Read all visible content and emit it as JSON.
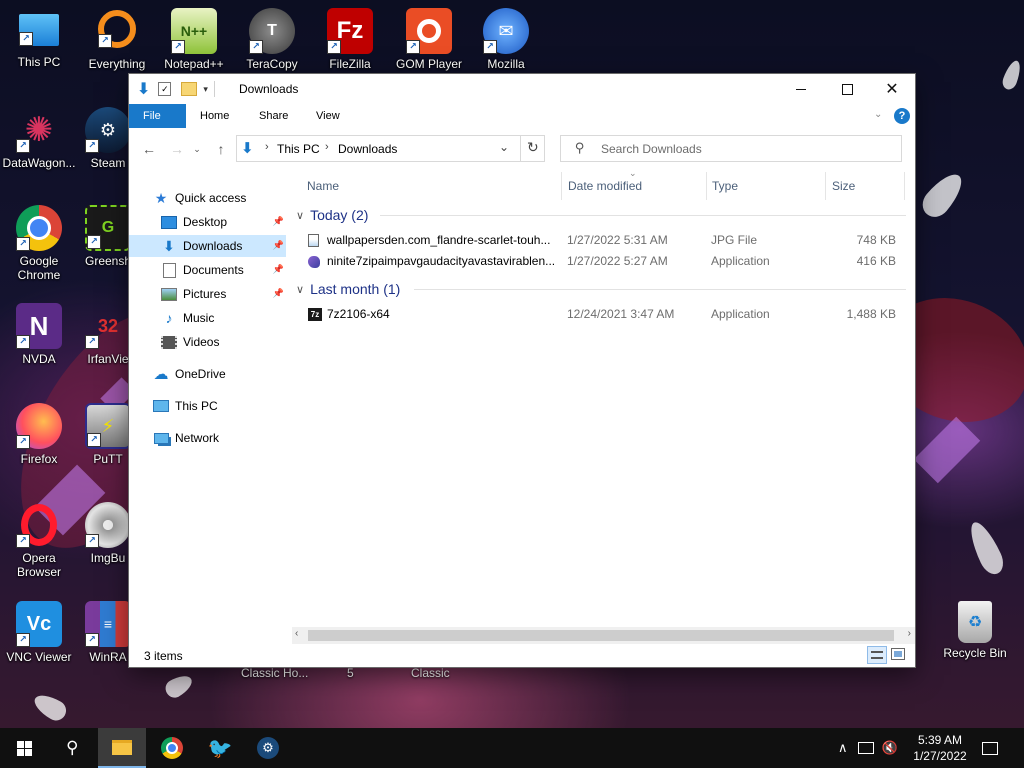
{
  "desktop": {
    "icons": [
      {
        "label": "This PC",
        "icon": "computer-icon"
      },
      {
        "label": "Everything",
        "icon": "magnifier-icon"
      },
      {
        "label": "Notepad++",
        "icon": "notepadpp-icon"
      },
      {
        "label": "TeraCopy",
        "icon": "teracopy-icon"
      },
      {
        "label": "FileZilla",
        "icon": "filezilla-icon"
      },
      {
        "label": "GOM Player",
        "icon": "gom-player-icon"
      },
      {
        "label": "Mozilla",
        "icon": "thunderbird-icon"
      },
      {
        "label": "DataWagon...",
        "icon": "datawagon-icon"
      },
      {
        "label": "Steam",
        "icon": "steam-icon"
      },
      {
        "label": "Google Chrome",
        "icon": "chrome-icon"
      },
      {
        "label": "Greensh",
        "icon": "greenshot-icon"
      },
      {
        "label": "NVDA",
        "icon": "nvda-icon"
      },
      {
        "label": "IrfanVie",
        "icon": "irfanview-icon"
      },
      {
        "label": "Firefox",
        "icon": "firefox-icon"
      },
      {
        "label": "PuTT",
        "icon": "putty-icon"
      },
      {
        "label": "Opera Browser",
        "icon": "opera-icon"
      },
      {
        "label": "ImgBu",
        "icon": "imgburn-icon"
      },
      {
        "label": "VNC Viewer",
        "icon": "vnc-icon"
      },
      {
        "label": "WinRA",
        "icon": "winrar-icon"
      },
      {
        "label": "Recycle Bin",
        "icon": "recycle-bin-icon"
      }
    ],
    "behind_labels": [
      "Classic Ho...",
      "5",
      "Classic"
    ]
  },
  "window": {
    "title": "Downloads",
    "ribbon_tabs": [
      "File",
      "Home",
      "Share",
      "View"
    ],
    "breadcrumb": [
      "This PC",
      "Downloads"
    ],
    "search_placeholder": "Search Downloads",
    "nav": [
      {
        "label": "Quick access",
        "icon": "star-icon"
      },
      {
        "label": "Desktop",
        "icon": "desktop-folder-icon",
        "pinned": true
      },
      {
        "label": "Downloads",
        "icon": "download-arrow-icon",
        "pinned": true,
        "selected": true
      },
      {
        "label": "Documents",
        "icon": "document-icon",
        "pinned": true
      },
      {
        "label": "Pictures",
        "icon": "pictures-icon",
        "pinned": true
      },
      {
        "label": "Music",
        "icon": "music-note-icon"
      },
      {
        "label": "Videos",
        "icon": "film-icon"
      },
      {
        "label": "OneDrive",
        "icon": "cloud-icon"
      },
      {
        "label": "This PC",
        "icon": "computer-icon"
      },
      {
        "label": "Network",
        "icon": "network-icon"
      }
    ],
    "columns": [
      "Name",
      "Date modified",
      "Type",
      "Size"
    ],
    "groups": [
      {
        "label": "Today (2)",
        "files": [
          {
            "name": "wallpapersden.com_flandre-scarlet-touh...",
            "date": "1/27/2022 5:31 AM",
            "type": "JPG File",
            "size": "748 KB",
            "icon": "image-file-icon"
          },
          {
            "name": "ninite7zipaimpavgaudacityavastavirablen...",
            "date": "1/27/2022 5:27 AM",
            "type": "Application",
            "size": "416 KB",
            "icon": "ninite-icon"
          }
        ]
      },
      {
        "label": "Last month (1)",
        "files": [
          {
            "name": "7z2106-x64",
            "date": "12/24/2021 3:47 AM",
            "type": "Application",
            "size": "1,488 KB",
            "icon": "7zip-icon"
          }
        ]
      }
    ],
    "status": "3 items"
  },
  "taskbar": {
    "clock_time": "5:39 AM",
    "clock_date": "1/27/2022"
  }
}
